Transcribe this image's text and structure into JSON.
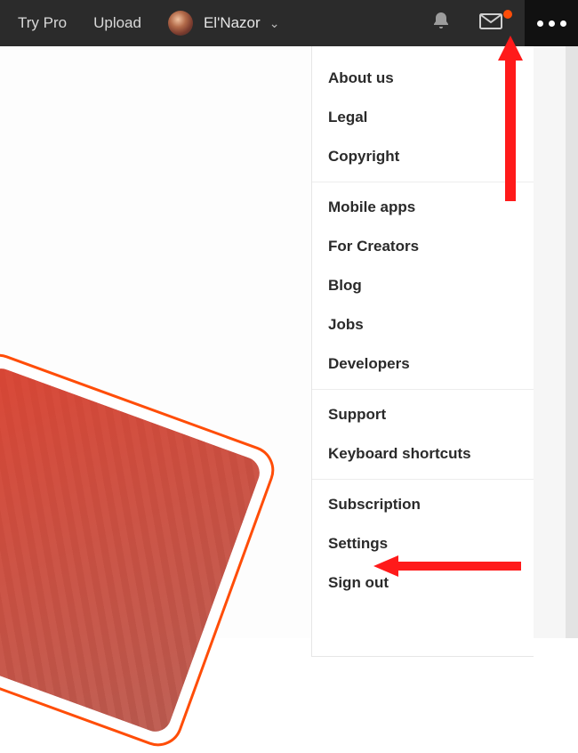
{
  "nav": {
    "try_pro": "Try Pro",
    "upload": "Upload",
    "user_name": "El'Nazor"
  },
  "icons": {
    "bell": "bell-icon",
    "mail": "mail-icon",
    "more": "more-icon",
    "chevron": "chevron-down-icon",
    "avatar": "user-avatar"
  },
  "menu": {
    "groups": [
      [
        "About us",
        "Legal",
        "Copyright"
      ],
      [
        "Mobile apps",
        "For Creators",
        "Blog",
        "Jobs",
        "Developers"
      ],
      [
        "Support",
        "Keyboard shortcuts"
      ],
      [
        "Subscription",
        "Settings",
        "Sign out"
      ]
    ]
  },
  "annotations": {
    "arrow_to_more": "arrow-up",
    "arrow_to_settings": "arrow-left"
  }
}
